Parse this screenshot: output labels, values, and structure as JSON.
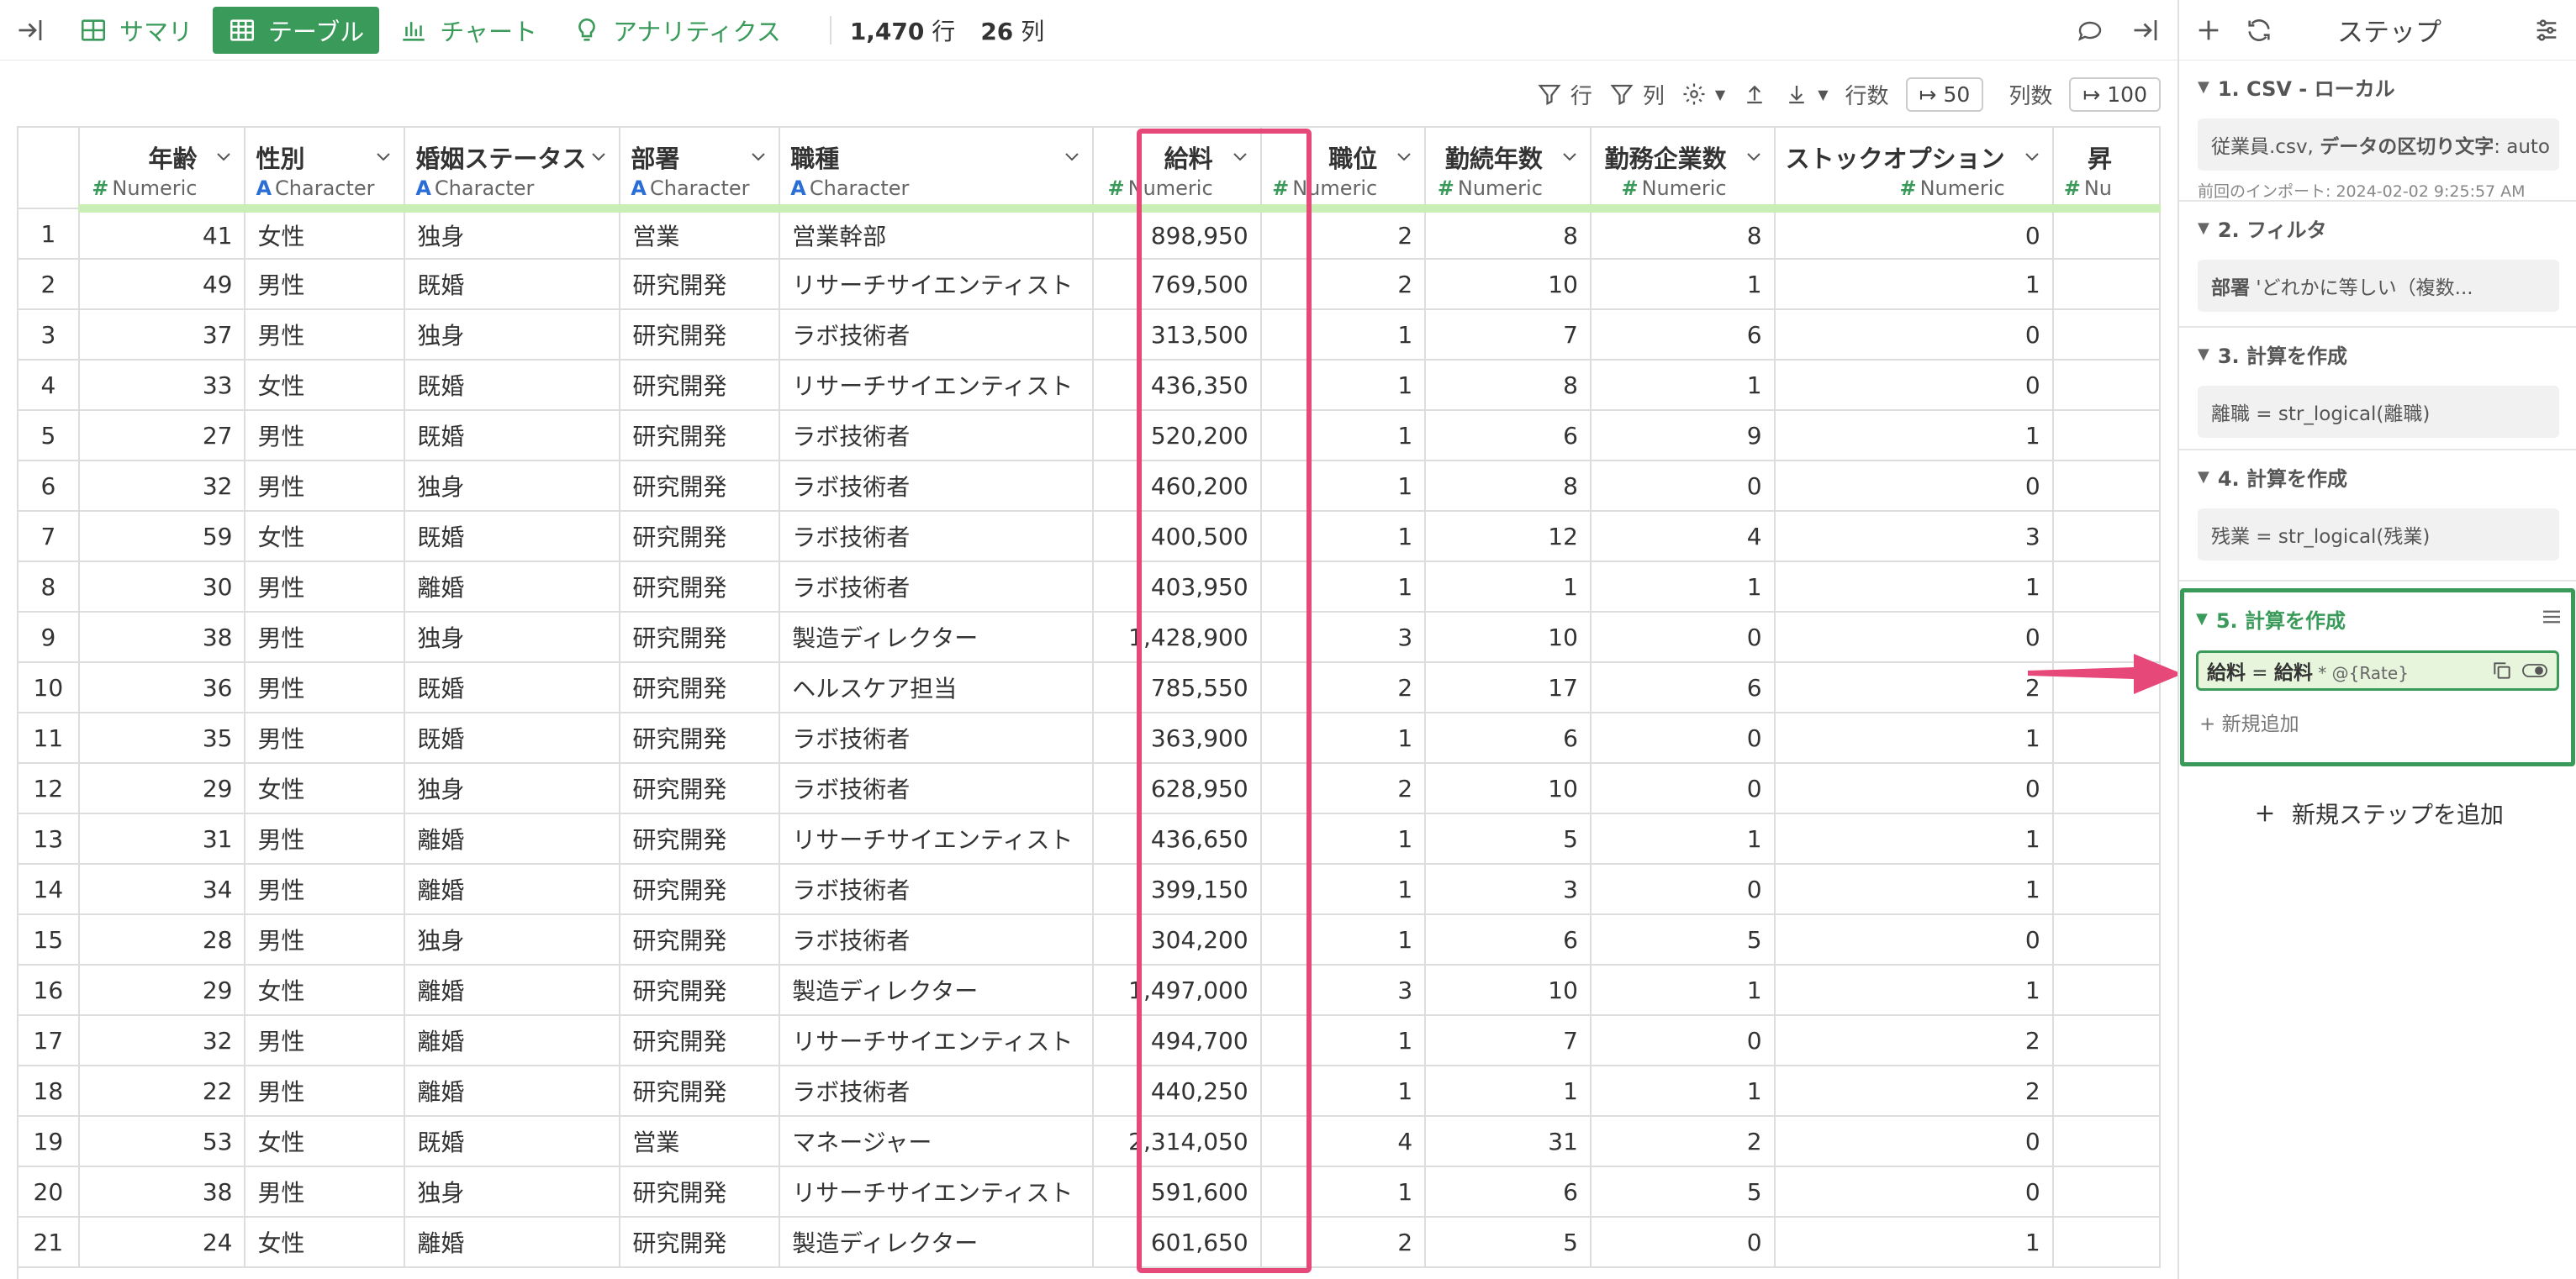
{
  "topbar": {
    "tabs": [
      {
        "label": "サマリ",
        "icon": "summary-grid-icon"
      },
      {
        "label": "テーブル",
        "icon": "table-icon"
      },
      {
        "label": "チャート",
        "icon": "bar-chart-icon"
      },
      {
        "label": "アナリティクス",
        "icon": "lightbulb-icon"
      }
    ],
    "rows_count": "1,470",
    "rows_unit": "行",
    "cols_count": "26",
    "cols_unit": "列"
  },
  "toolbar": {
    "filter_row": "行",
    "filter_col": "列",
    "rows_label": "行数",
    "rows_value": "50",
    "cols_label": "列数",
    "cols_value": "100"
  },
  "table": {
    "columns": [
      {
        "name": "年齢",
        "type": "Numeric",
        "kind": "num"
      },
      {
        "name": "性別",
        "type": "Character",
        "kind": "chr"
      },
      {
        "name": "婚姻ステータス",
        "type": "Character",
        "kind": "chr"
      },
      {
        "name": "部署",
        "type": "Character",
        "kind": "chr"
      },
      {
        "name": "職種",
        "type": "Character",
        "kind": "chr"
      },
      {
        "name": "給料",
        "type": "Numeric",
        "kind": "num"
      },
      {
        "name": "職位",
        "type": "Numeric",
        "kind": "num"
      },
      {
        "name": "勤続年数",
        "type": "Numeric",
        "kind": "num"
      },
      {
        "name": "勤務企業数",
        "type": "Numeric",
        "kind": "num"
      },
      {
        "name": "ストックオプション",
        "type": "Numeric",
        "kind": "num"
      },
      {
        "name": "昇",
        "type": "Nu",
        "kind": "num"
      }
    ],
    "rows": [
      [
        "1",
        "41",
        "女性",
        "独身",
        "営業",
        "営業幹部",
        "898,950",
        "2",
        "8",
        "8",
        "0",
        ""
      ],
      [
        "2",
        "49",
        "男性",
        "既婚",
        "研究開発",
        "リサーチサイエンティスト",
        "769,500",
        "2",
        "10",
        "1",
        "1",
        ""
      ],
      [
        "3",
        "37",
        "男性",
        "独身",
        "研究開発",
        "ラボ技術者",
        "313,500",
        "1",
        "7",
        "6",
        "0",
        ""
      ],
      [
        "4",
        "33",
        "女性",
        "既婚",
        "研究開発",
        "リサーチサイエンティスト",
        "436,350",
        "1",
        "8",
        "1",
        "0",
        ""
      ],
      [
        "5",
        "27",
        "男性",
        "既婚",
        "研究開発",
        "ラボ技術者",
        "520,200",
        "1",
        "6",
        "9",
        "1",
        ""
      ],
      [
        "6",
        "32",
        "男性",
        "独身",
        "研究開発",
        "ラボ技術者",
        "460,200",
        "1",
        "8",
        "0",
        "0",
        ""
      ],
      [
        "7",
        "59",
        "女性",
        "既婚",
        "研究開発",
        "ラボ技術者",
        "400,500",
        "1",
        "12",
        "4",
        "3",
        ""
      ],
      [
        "8",
        "30",
        "男性",
        "離婚",
        "研究開発",
        "ラボ技術者",
        "403,950",
        "1",
        "1",
        "1",
        "1",
        ""
      ],
      [
        "9",
        "38",
        "男性",
        "独身",
        "研究開発",
        "製造ディレクター",
        "1,428,900",
        "3",
        "10",
        "0",
        "0",
        ""
      ],
      [
        "10",
        "36",
        "男性",
        "既婚",
        "研究開発",
        "ヘルスケア担当",
        "785,550",
        "2",
        "17",
        "6",
        "2",
        ""
      ],
      [
        "11",
        "35",
        "男性",
        "既婚",
        "研究開発",
        "ラボ技術者",
        "363,900",
        "1",
        "6",
        "0",
        "1",
        ""
      ],
      [
        "12",
        "29",
        "女性",
        "独身",
        "研究開発",
        "ラボ技術者",
        "628,950",
        "2",
        "10",
        "0",
        "0",
        ""
      ],
      [
        "13",
        "31",
        "男性",
        "離婚",
        "研究開発",
        "リサーチサイエンティスト",
        "436,650",
        "1",
        "5",
        "1",
        "1",
        ""
      ],
      [
        "14",
        "34",
        "男性",
        "離婚",
        "研究開発",
        "ラボ技術者",
        "399,150",
        "1",
        "3",
        "0",
        "1",
        ""
      ],
      [
        "15",
        "28",
        "男性",
        "独身",
        "研究開発",
        "ラボ技術者",
        "304,200",
        "1",
        "6",
        "5",
        "0",
        ""
      ],
      [
        "16",
        "29",
        "女性",
        "離婚",
        "研究開発",
        "製造ディレクター",
        "1,497,000",
        "3",
        "10",
        "1",
        "1",
        ""
      ],
      [
        "17",
        "32",
        "男性",
        "離婚",
        "研究開発",
        "リサーチサイエンティスト",
        "494,700",
        "1",
        "7",
        "0",
        "2",
        ""
      ],
      [
        "18",
        "22",
        "男性",
        "離婚",
        "研究開発",
        "ラボ技術者",
        "440,250",
        "1",
        "1",
        "1",
        "2",
        ""
      ],
      [
        "19",
        "53",
        "女性",
        "既婚",
        "営業",
        "マネージャー",
        "2,314,050",
        "4",
        "31",
        "2",
        "0",
        ""
      ],
      [
        "20",
        "38",
        "男性",
        "独身",
        "研究開発",
        "リサーチサイエンティスト",
        "591,600",
        "1",
        "6",
        "5",
        "0",
        ""
      ],
      [
        "21",
        "24",
        "女性",
        "離婚",
        "研究開発",
        "製造ディレクター",
        "601,650",
        "2",
        "5",
        "0",
        "1",
        ""
      ]
    ]
  },
  "panel": {
    "title": "ステップ",
    "steps": [
      {
        "title": "1. CSV - ローカル",
        "card_prefix": "従業員.csv, ",
        "card_bold": "データの区切り文字",
        "card_suffix": ": auto",
        "note": "前回のインポート: 2024-02-02 9:25:57 AM"
      },
      {
        "title": "2. フィルタ",
        "card_bold": "部署",
        "card_suffix": " 'どれかに等しい（複数..."
      },
      {
        "title": "3. 計算を作成",
        "card": "離職 = str_logical(離職)"
      },
      {
        "title": "4. 計算を作成",
        "card": "残業 = str_logical(残業)"
      }
    ],
    "active_step": {
      "title": "5. 計算を作成",
      "lhs": "給料",
      "op": " = ",
      "rhs": "給料",
      "rate": " * @{Rate}",
      "add_new": "+ 新規追加"
    },
    "add_step": "新規ステップを追加"
  }
}
